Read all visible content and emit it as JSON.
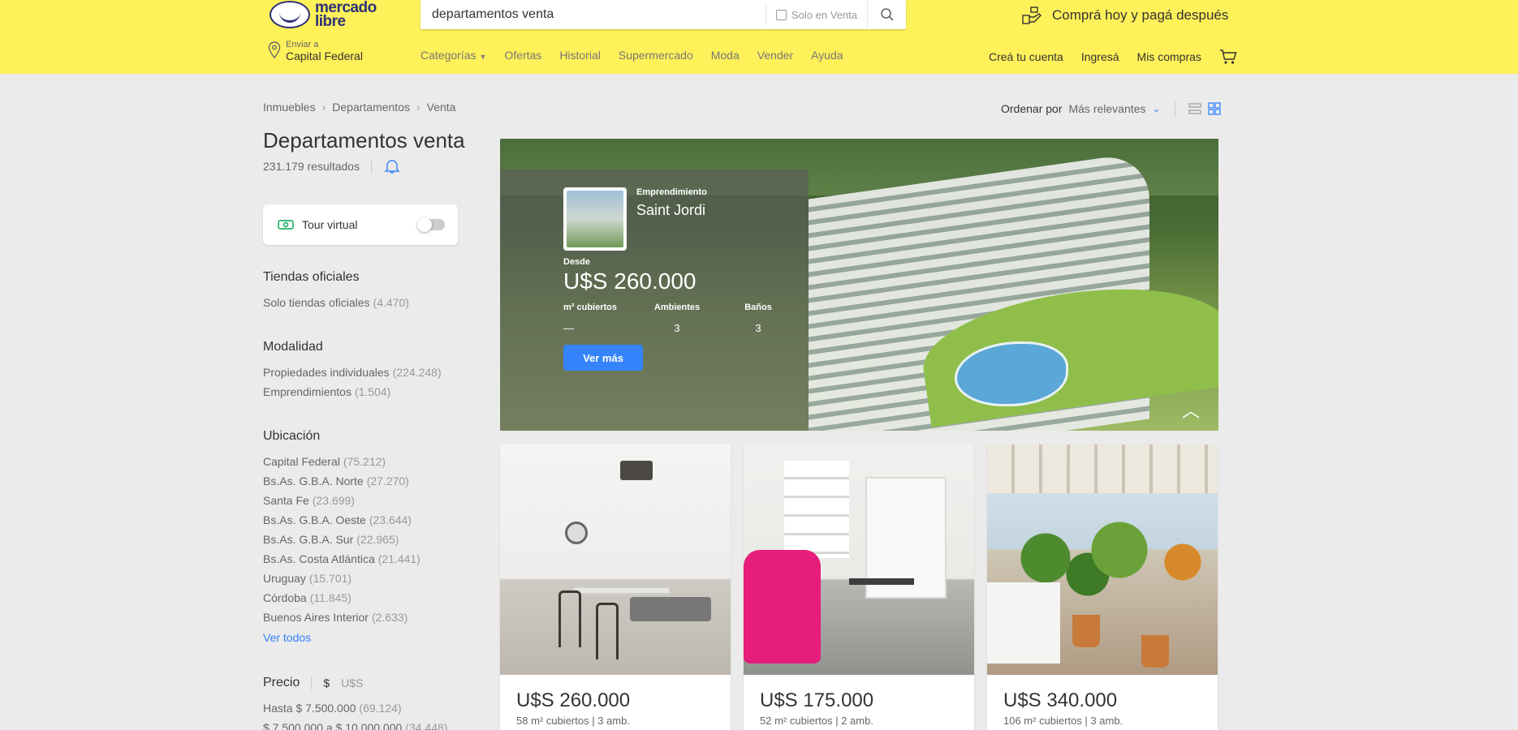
{
  "header": {
    "logo_line1": "mercado",
    "logo_line2": "libre",
    "search_value": "departamentos venta",
    "solo_label": "Solo en Venta",
    "promo": "Comprá hoy y pagá después",
    "location_label": "Enviar a",
    "location_value": "Capital Federal",
    "nav": [
      "Categorías",
      "Ofertas",
      "Historial",
      "Supermercado",
      "Moda",
      "Vender",
      "Ayuda"
    ],
    "user_nav": [
      "Creá tu cuenta",
      "Ingresá",
      "Mis compras"
    ]
  },
  "breadcrumb": [
    "Inmuebles",
    "Departamentos",
    "Venta"
  ],
  "sort": {
    "label": "Ordenar por",
    "value": "Más relevantes"
  },
  "page": {
    "title": "Departamentos venta",
    "results": "231.179 resultados"
  },
  "tour": {
    "label": "Tour virtual"
  },
  "filters": {
    "oficiales": {
      "title": "Tiendas oficiales",
      "options": [
        {
          "label": "Solo tiendas oficiales",
          "count": "(4.470)"
        }
      ]
    },
    "modalidad": {
      "title": "Modalidad",
      "options": [
        {
          "label": "Propiedades individuales",
          "count": "(224.248)"
        },
        {
          "label": "Emprendimientos",
          "count": "(1.504)"
        }
      ]
    },
    "ubicacion": {
      "title": "Ubicación",
      "options": [
        {
          "label": "Capital Federal",
          "count": "(75.212)"
        },
        {
          "label": "Bs.As. G.B.A. Norte",
          "count": "(27.270)"
        },
        {
          "label": "Santa Fe",
          "count": "(23.699)"
        },
        {
          "label": "Bs.As. G.B.A. Oeste",
          "count": "(23.644)"
        },
        {
          "label": "Bs.As. G.B.A. Sur",
          "count": "(22.965)"
        },
        {
          "label": "Bs.As. Costa Atlántica",
          "count": "(21.441)"
        },
        {
          "label": "Uruguay",
          "count": "(15.701)"
        },
        {
          "label": "Córdoba",
          "count": "(11.845)"
        },
        {
          "label": "Buenos Aires Interior",
          "count": "(2.633)"
        }
      ],
      "see_all": "Ver todos"
    },
    "precio": {
      "title": "Precio",
      "currency_ars": "$",
      "currency_usd": "U$S",
      "options": [
        {
          "label": "Hasta $ 7.500.000",
          "count": "(69.124)"
        },
        {
          "label": "$ 7.500.000 a $ 10.000.000",
          "count": "(34.448)"
        }
      ]
    }
  },
  "banner": {
    "badge": "Emprendimiento",
    "name": "Saint Jordi",
    "from_label": "Desde",
    "price": "U$S 260.000",
    "specs": [
      {
        "label": "m² cubiertos",
        "value": "—"
      },
      {
        "label": "Ambientes",
        "value": "3"
      },
      {
        "label": "Baños",
        "value": "3"
      }
    ],
    "button": "Ver más"
  },
  "cards": [
    {
      "price": "U$S 260.000",
      "desc": "58 m² cubiertos | 3 amb."
    },
    {
      "price": "U$S 175.000",
      "desc": "52 m² cubiertos | 2 amb."
    },
    {
      "price": "U$S 340.000",
      "desc": "106 m² cubiertos | 3 amb."
    }
  ],
  "colors": {
    "header_bg": "#fff159",
    "accent": "#3483fa",
    "page_bg": "#ebebeb"
  },
  "icons": [
    "logo-handshake-icon",
    "search-icon",
    "credit-icon",
    "location-pin-icon",
    "chevron-down-icon",
    "cart-icon",
    "breadcrumb-chevron-icon",
    "bell-icon",
    "list-view-icon",
    "grid-view-icon",
    "tour-360-icon"
  ]
}
